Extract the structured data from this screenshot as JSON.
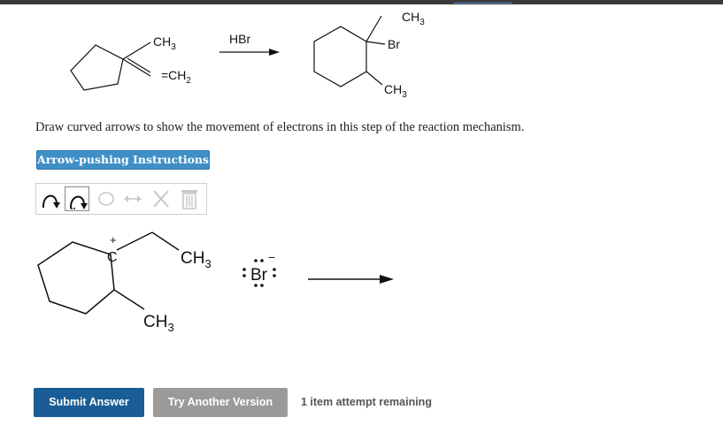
{
  "header": {
    "link_label": ""
  },
  "reaction": {
    "reactant_labels": {
      "ch3": "CH",
      "ch2": "=CH",
      "sub3": "3",
      "sub2": "2"
    },
    "reagent": "HBr",
    "product_labels": {
      "ch3_top": "CH",
      "br": "Br",
      "ch3_bottom": "CH",
      "sub3": "3"
    }
  },
  "question": {
    "text": "Draw curved arrows to show the movement of electrons in this step of the reaction mechanism."
  },
  "instructions_button": {
    "label": "Arrow-pushing Instructions"
  },
  "toolbar": {
    "tools": [
      "curved-arrow-icon",
      "single-electron-arrow-icon",
      "lasso-icon",
      "resonance-arrow-icon",
      "delete-icon",
      "trash-icon"
    ]
  },
  "mechanism": {
    "carbocation_symbol": "C",
    "charge_plus": "+",
    "ch3_right": "CH",
    "ch3_bottom": "CH",
    "sub3": "3",
    "bromide": "Br",
    "charge_minus": "−"
  },
  "buttons": {
    "submit": "Submit Answer",
    "try_another": "Try Another Version"
  },
  "status": {
    "attempts": "1 item attempt remaining"
  },
  "colors": {
    "primary": "#1a5c95",
    "secondary": "#9a9a9a",
    "instructions": "#3f8fc7"
  }
}
